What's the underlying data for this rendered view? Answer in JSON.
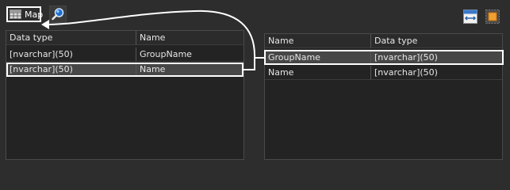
{
  "toolbar": {
    "map_label": "Map",
    "icons": {
      "map": "grid-icon",
      "search": "magnifier-icon",
      "fit": "fit-width-icon",
      "settings": "orange-square-icon"
    }
  },
  "left_table": {
    "headers": [
      "Data type",
      "Name"
    ],
    "rows": [
      [
        "[nvarchar](50)",
        "GroupName"
      ],
      [
        "[nvarchar](50)",
        "Name"
      ]
    ],
    "selected_row": 1
  },
  "right_table": {
    "headers": [
      "Name",
      "Data type"
    ],
    "rows": [
      [
        "GroupName",
        "[nvarchar](50)"
      ],
      [
        "Name",
        "[nvarchar](50)"
      ]
    ],
    "selected_row": 0
  },
  "colors": {
    "background": "#2d2d2d",
    "panel": "#232323",
    "highlight": "#ffffff",
    "selected_row": "#474747"
  }
}
